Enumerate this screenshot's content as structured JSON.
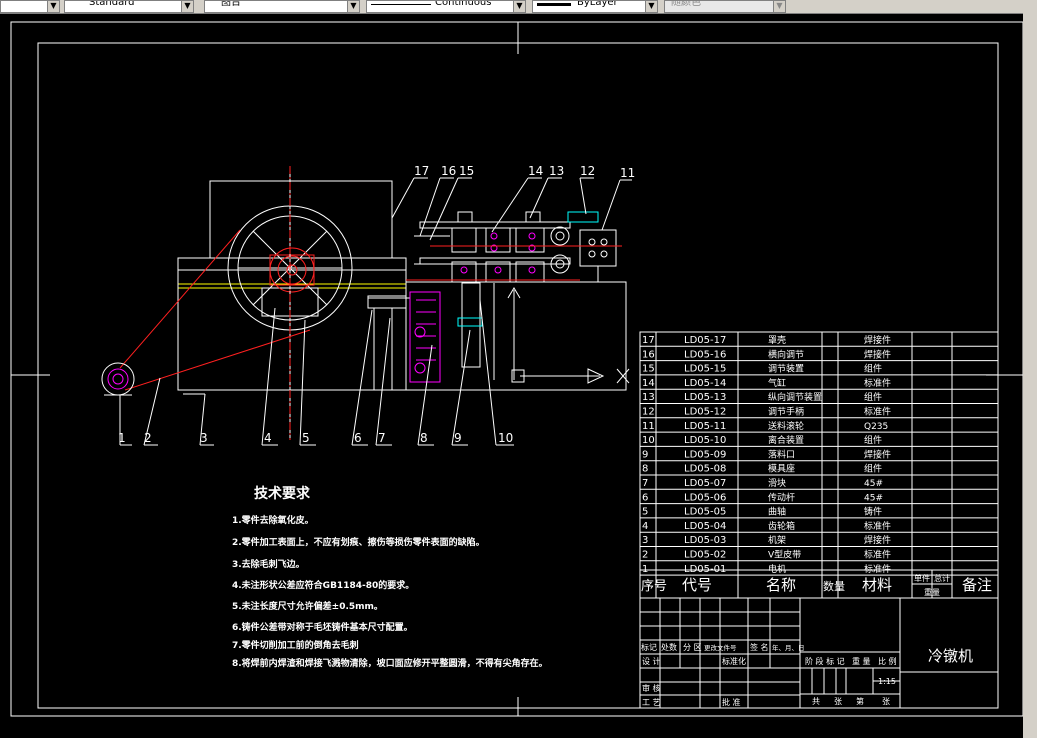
{
  "toolbar": {
    "text_style": "Standard",
    "layer": "图台",
    "linetype": "Continuous",
    "lineweight": "ByLayer",
    "plot_style": "随颜色"
  },
  "callouts": [
    "1",
    "2",
    "3",
    "4",
    "5",
    "6",
    "7",
    "8",
    "9",
    "10",
    "11",
    "12",
    "13",
    "14",
    "15",
    "16",
    "17"
  ],
  "notes": {
    "title": "技术要求",
    "items": [
      "1.零件去除氧化皮。",
      "2.零件加工表面上，不应有划痕、擦伤等损伤零件表面的缺陷。",
      "3.去除毛刺飞边。",
      "4.未注形状公差应符合GB1184-80的要求。",
      "5.未注长度尺寸允许偏差±0.5mm。",
      "6.铸件公差带对称于毛坯铸件基本尺寸配置。",
      "7.零件切削加工前的倒角去毛刺",
      "8.将焊前内焊渣和焊接飞溅物清除，坡口面应修开平整圆滑，不得有尖角存在。"
    ]
  },
  "parts": [
    {
      "no": "17",
      "code": "LD05-17",
      "name": "罩壳",
      "material": "焊接件"
    },
    {
      "no": "16",
      "code": "LD05-16",
      "name": "横向调节",
      "material": "焊接件"
    },
    {
      "no": "15",
      "code": "LD05-15",
      "name": "调节装置",
      "material": "组件"
    },
    {
      "no": "14",
      "code": "LD05-14",
      "name": "气缸",
      "material": "标准件"
    },
    {
      "no": "13",
      "code": "LD05-13",
      "name": "纵向调节装置",
      "material": "组件"
    },
    {
      "no": "12",
      "code": "LD05-12",
      "name": "调节手柄",
      "material": "标准件"
    },
    {
      "no": "11",
      "code": "LD05-11",
      "name": "送料滚轮",
      "material": "Q235"
    },
    {
      "no": "10",
      "code": "LD05-10",
      "name": "离合装置",
      "material": "组件"
    },
    {
      "no": "9",
      "code": "LD05-09",
      "name": "落料口",
      "material": "焊接件"
    },
    {
      "no": "8",
      "code": "LD05-08",
      "name": "模具座",
      "material": "组件"
    },
    {
      "no": "7",
      "code": "LD05-07",
      "name": "滑块",
      "material": "45#"
    },
    {
      "no": "6",
      "code": "LD05-06",
      "name": "传动杆",
      "material": "45#"
    },
    {
      "no": "5",
      "code": "LD05-05",
      "name": "曲轴",
      "material": "铸件"
    },
    {
      "no": "4",
      "code": "LD05-04",
      "name": "齿轮箱",
      "material": "标准件"
    },
    {
      "no": "3",
      "code": "LD05-03",
      "name": "机架",
      "material": "焊接件"
    },
    {
      "no": "2",
      "code": "LD05-02",
      "name": "V型皮带",
      "material": "标准件"
    },
    {
      "no": "1",
      "code": "LD05-01",
      "name": "电机",
      "material": "标准件"
    }
  ],
  "bom_header": {
    "no": "序号",
    "code": "代号",
    "name": "名称",
    "qty": "数量",
    "material": "材料",
    "unit_w": "单件",
    "total_w": "总计",
    "weight": "重量",
    "remark": "备注"
  },
  "title_block": {
    "drawing_name": "冷镦机",
    "scale": "1:15",
    "rev_row": [
      "标记",
      "处数",
      "分 区",
      "更改文件号",
      "签 名",
      "年、月、日"
    ],
    "design": "设 计",
    "standardize": "标准化",
    "stage_row": [
      "阶 段 标 记",
      "重 量",
      "比 例"
    ],
    "review": "审 核",
    "process": "工 艺",
    "approve": "批 准",
    "sheet_row": [
      "共",
      "张",
      "第",
      "张"
    ]
  },
  "colors": {
    "line": "#ffffff",
    "red": "#ff2020",
    "magenta": "#ff00ff",
    "cyan": "#00ffff",
    "yellow": "#ffff00"
  }
}
